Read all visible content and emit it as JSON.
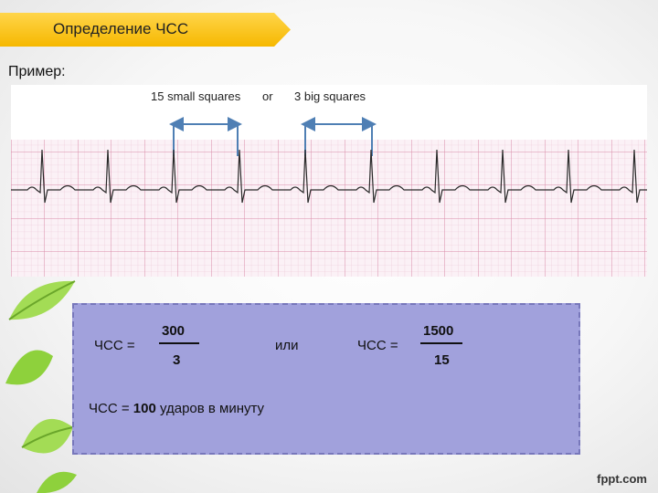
{
  "slide": {
    "title": "Определение ЧСС",
    "example_label": "Пример:"
  },
  "ecg": {
    "annotation_small": "15 small squares",
    "annotation_or": "or",
    "annotation_big": "3 big squares"
  },
  "formula": {
    "left_label": "ЧСС  =",
    "left_numerator": "300",
    "left_denominator": "3",
    "connector": "или",
    "right_label": "ЧСС  =",
    "right_numerator": "1500",
    "right_denominator": "15",
    "result_prefix": "ЧСС  =",
    "result_value": "100",
    "result_suffix": "ударов в минуту"
  },
  "footer": {
    "logo": "fppt.com"
  },
  "colors": {
    "banner": "#f6b800",
    "formula_bg": "#a1a1dc",
    "grid": "#e2a9c0",
    "arrows": "#4f7fb4"
  },
  "icons": [
    "leaf-icon"
  ]
}
